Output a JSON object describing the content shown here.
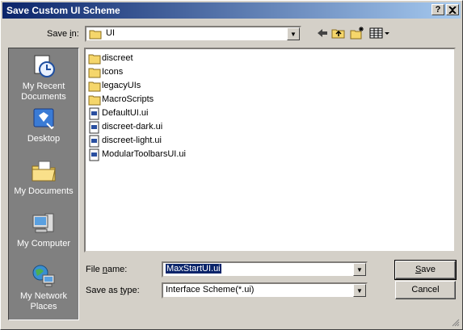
{
  "window": {
    "title": "Save Custom UI Scheme",
    "help_btn": "?",
    "close_btn": "X"
  },
  "save_in": {
    "label_pre": "Save ",
    "label_u": "i",
    "label_post": "n:",
    "value": "UI"
  },
  "places": [
    {
      "label": "My Recent Documents",
      "icon": "recent-documents-icon"
    },
    {
      "label": "Desktop",
      "icon": "desktop-icon"
    },
    {
      "label": "My Documents",
      "icon": "my-documents-icon"
    },
    {
      "label": "My Computer",
      "icon": "my-computer-icon"
    },
    {
      "label": "My Network Places",
      "icon": "network-places-icon"
    }
  ],
  "files": [
    {
      "name": "discreet",
      "type": "folder"
    },
    {
      "name": "Icons",
      "type": "folder"
    },
    {
      "name": "legacyUIs",
      "type": "folder"
    },
    {
      "name": "MacroScripts",
      "type": "folder"
    },
    {
      "name": "DefaultUI.ui",
      "type": "file"
    },
    {
      "name": "discreet-dark.ui",
      "type": "file"
    },
    {
      "name": "discreet-light.ui",
      "type": "file"
    },
    {
      "name": "ModularToolbarsUI.ui",
      "type": "file"
    }
  ],
  "file_name": {
    "label_pre": "File ",
    "label_u": "n",
    "label_post": "ame:",
    "value": "MaxStartUI.ui"
  },
  "save_as_type": {
    "label_pre": "Save as ",
    "label_u": "t",
    "label_post": "ype:",
    "value": "Interface Scheme(*.ui)"
  },
  "buttons": {
    "save_u": "S",
    "save_rest": "ave",
    "cancel": "Cancel"
  },
  "colors": {
    "title_start": "#0a246a",
    "title_end": "#a6caf0",
    "dialog_bg": "#d4d0c8",
    "places_bg": "#808080",
    "folder": "#f5d66b"
  }
}
